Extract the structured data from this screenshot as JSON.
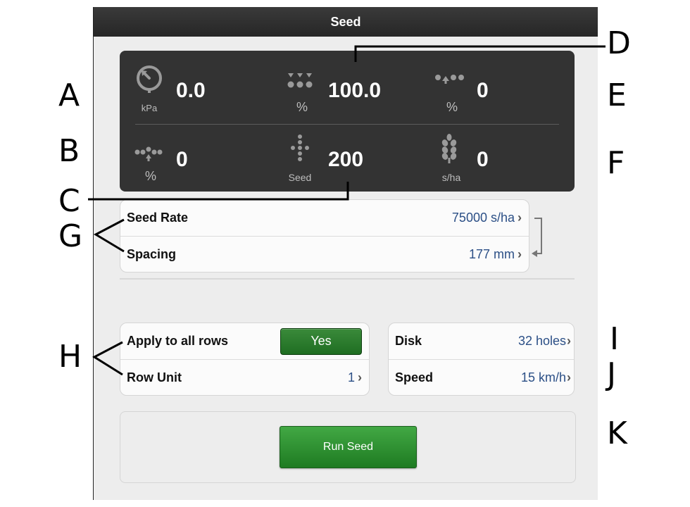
{
  "screen": {
    "title": "Seed"
  },
  "callouts": [
    "A",
    "B",
    "C",
    "D",
    "E",
    "F",
    "G",
    "H",
    "I",
    "J",
    "K"
  ],
  "gauges": [
    {
      "icon": "pressure-gauge-icon",
      "unit": "kPa",
      "value": "0.0"
    },
    {
      "icon": "seed-flow-icon",
      "unit": "%",
      "value": "100.0"
    },
    {
      "icon": "skip-seed-icon",
      "unit": "%",
      "value": "0"
    },
    {
      "icon": "double-seed-icon",
      "unit": "%",
      "value": "0"
    },
    {
      "icon": "seed-spacing-icon",
      "unit": "Seed",
      "value": "200"
    },
    {
      "icon": "wheat-icon",
      "unit": "s/ha",
      "value": "0"
    }
  ],
  "rate_card": {
    "seed_rate_label": "Seed Rate",
    "seed_rate_value": "75000 s/ha",
    "spacing_label": "Spacing",
    "spacing_value": "177 mm"
  },
  "rows_card": {
    "apply_label": "Apply to all rows",
    "apply_value": "Yes",
    "row_unit_label": "Row Unit",
    "row_unit_value": "1"
  },
  "disk_card": {
    "disk_label": "Disk",
    "disk_value": "32 holes",
    "speed_label": "Speed",
    "speed_value": "15 km/h"
  },
  "run_button_label": "Run Seed",
  "colors": {
    "titlebar": "#2e2e2e",
    "panel": "#333333",
    "value_link": "#2b4f86",
    "green": "#2e8b32"
  }
}
